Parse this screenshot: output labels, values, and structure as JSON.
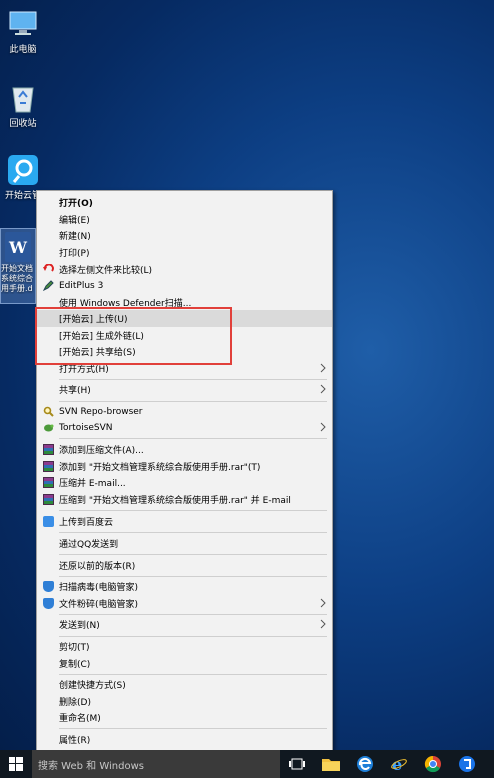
{
  "desktop": {
    "icons": [
      {
        "label": "此电脑"
      },
      {
        "label": "回收站"
      },
      {
        "label": "开始云管"
      }
    ],
    "selected_file": {
      "icon_letter": "W",
      "label_lines": [
        "开始文档",
        "系统综合",
        "用手册.d"
      ]
    }
  },
  "context_menu": {
    "items": {
      "open": "打开(O)",
      "edit": "编辑(E)",
      "new": "新建(N)",
      "print": "打印(P)",
      "compare": "选择左侧文件来比较(L)",
      "editplus": "EditPlus 3",
      "defender": "使用 Windows Defender扫描...",
      "kaishiyun_upload": "[开始云] 上传(U)",
      "kaishiyun_link": "[开始云] 生成外链(L)",
      "kaishiyun_share": "[开始云] 共享给(S)",
      "open_with": "打开方式(H)",
      "share": "共享(H)",
      "svn_repo": "SVN Repo-browser",
      "tortoise": "TortoiseSVN",
      "add_archive": "添加到压缩文件(A)...",
      "add_rar": "添加到 \"开始文档管理系统综合版使用手册.rar\"(T)",
      "compress_email": "压缩并 E-mail...",
      "compress_rar_email": "压缩到 \"开始文档管理系统综合版使用手册.rar\" 并 E-mail",
      "baidu": "上传到百度云",
      "qq": "通过QQ发送到",
      "restore": "还原以前的版本(R)",
      "scan": "扫描病毒(电脑管家)",
      "shred": "文件粉碎(电脑管家)",
      "send_to": "发送到(N)",
      "cut": "剪切(T)",
      "copy": "复制(C)",
      "shortcut": "创建快捷方式(S)",
      "delete": "删除(D)",
      "rename": "重命名(M)",
      "properties": "属性(R)"
    }
  },
  "taskbar": {
    "search_placeholder": "搜索 Web 和 Windows"
  },
  "colors": {
    "highlight_box": "#e1403a",
    "menu_bg": "#f2f2f2"
  }
}
